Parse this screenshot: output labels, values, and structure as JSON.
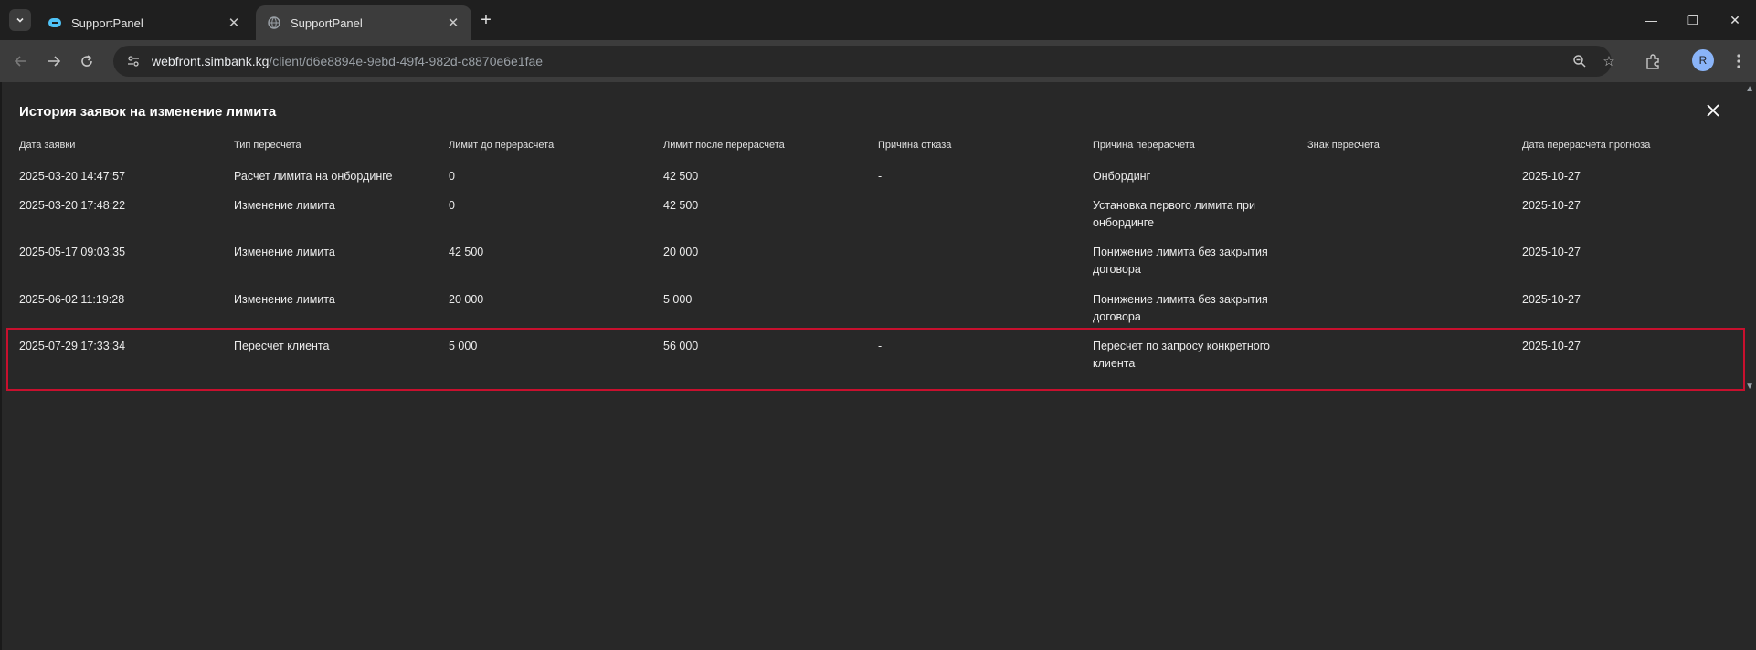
{
  "browser": {
    "tabs": [
      {
        "title": "SupportPanel",
        "active": false
      },
      {
        "title": "SupportPanel",
        "active": true
      }
    ],
    "url_host": "webfront.simbank.kg",
    "url_path": "/client/d6e8894e-9ebd-49f4-982d-c8870e6e1fae",
    "profile_initial": "R"
  },
  "modal": {
    "title": "История заявок на изменение лимита",
    "columns": [
      "Дата заявки",
      "Тип пересчета",
      "Лимит до перерасчета",
      "Лимит после перерасчета",
      "Причина отказа",
      "Причина перерасчета",
      "Знак пересчета",
      "Дата перерасчета прогноза"
    ],
    "rows": [
      [
        "2025-03-20 14:47:57",
        "Расчет лимита на онбординге",
        "0",
        "42 500",
        "-",
        "Онбординг",
        "",
        "2025-10-27"
      ],
      [
        "2025-03-20 17:48:22",
        "Изменение лимита",
        "0",
        "42 500",
        "",
        "Установка первого лимита при онбординге",
        "",
        "2025-10-27"
      ],
      [
        "2025-05-17 09:03:35",
        "Изменение лимита",
        "42 500",
        "20 000",
        "",
        "Понижение лимита без закрытия договора",
        "",
        "2025-10-27"
      ],
      [
        "2025-06-02 11:19:28",
        "Изменение лимита",
        "20 000",
        "5 000",
        "",
        "Понижение лимита без закрытия договора",
        "",
        "2025-10-27"
      ],
      [
        "2025-07-29 17:33:34",
        "Пересчет клиента",
        "5 000",
        "56 000",
        "-",
        "Пересчет по запросу конкретного клиента",
        "",
        "2025-10-27"
      ]
    ],
    "highlight_color": "#c8102e"
  }
}
